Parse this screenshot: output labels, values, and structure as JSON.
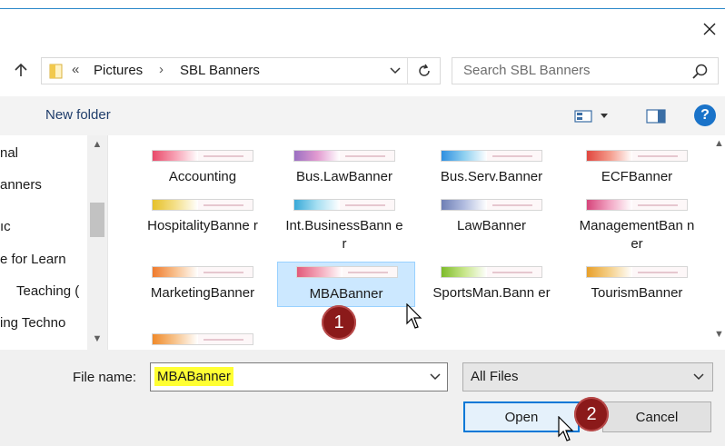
{
  "window": {
    "close_icon": "close-icon"
  },
  "address_bar": {
    "laquo": "«",
    "crumbs": [
      "Pictures",
      "SBL Banners"
    ],
    "separator": "›"
  },
  "search": {
    "placeholder": "Search SBL Banners"
  },
  "toolbar": {
    "new_folder": "New folder",
    "help": "?"
  },
  "nav_pane": {
    "items": [
      "nal",
      "anners",
      "ıc",
      "e for Learn",
      "Teaching (",
      "ing Techno"
    ]
  },
  "files": {
    "row1": [
      "Accounting",
      "Bus.LawBanner",
      "Bus.Serv.Banner",
      "ECFBanner"
    ],
    "row2": [
      "HospitalityBanne r",
      "Int.BusinessBann er",
      "LawBanner",
      "ManagementBan ner"
    ],
    "row3": [
      "MarketingBanner",
      "MBABanner",
      "SportsMan.Bann er",
      "TourismBanner"
    ],
    "selected": "MBABanner"
  },
  "bottom": {
    "filename_label": "File name:",
    "filename_value": "MBABanner",
    "filetype_value": "All Files",
    "open_label": "Open",
    "cancel_label": "Cancel"
  },
  "callouts": {
    "one": "1",
    "two": "2"
  },
  "colors": {
    "accent": "#0078d7",
    "selection": "#cce8ff",
    "highlight": "#ffff33",
    "badge": "#8b1a1a"
  }
}
